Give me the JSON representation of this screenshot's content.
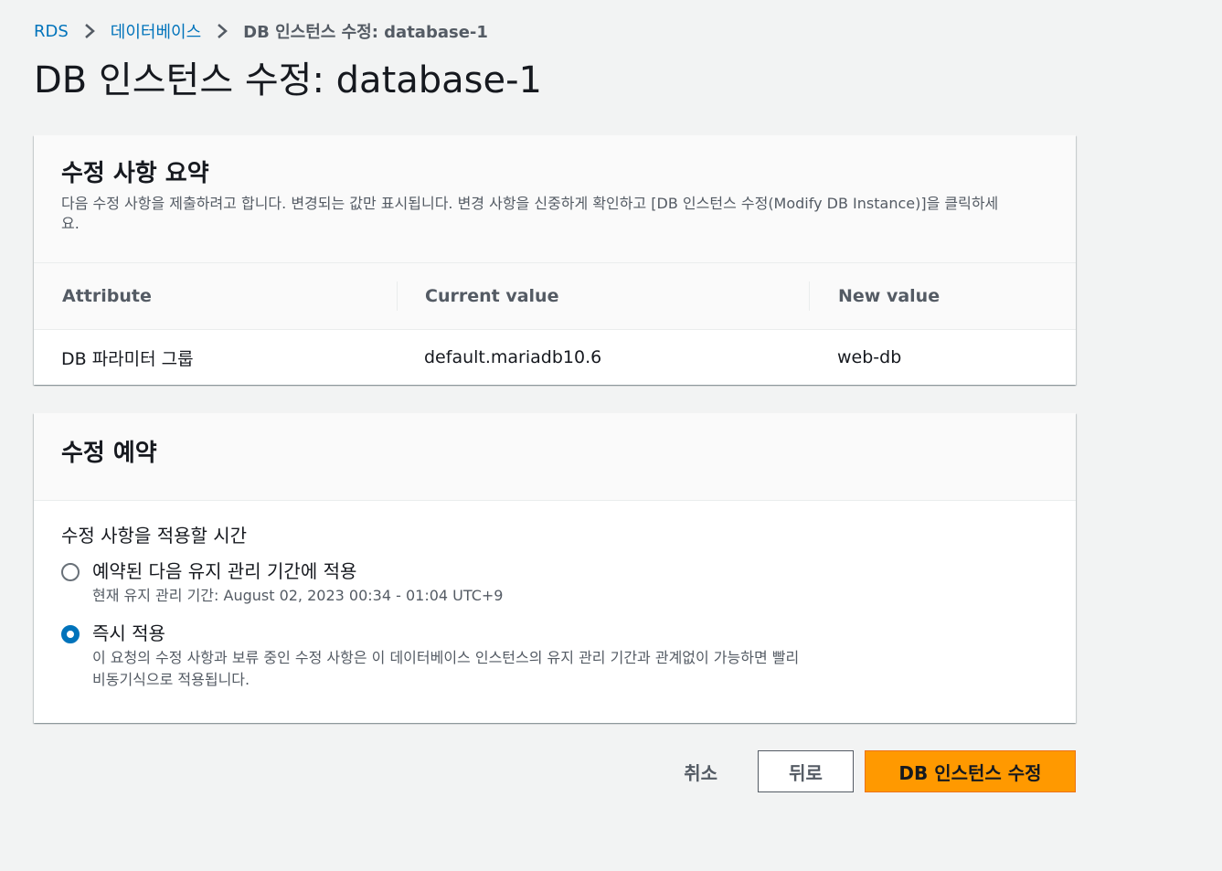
{
  "breadcrumb": {
    "items": [
      "RDS",
      "데이터베이스"
    ],
    "current": "DB 인스턴스 수정: database-1"
  },
  "page_title": "DB 인스턴스 수정: database-1",
  "summary": {
    "title": "수정 사항 요약",
    "description": "다음 수정 사항을 제출하려고 합니다. 변경되는 값만 표시됩니다. 변경 사항을 신중하게 확인하고 [DB 인스턴스 수정(Modify DB Instance)]을 클릭하세요.",
    "columns": [
      "Attribute",
      "Current value",
      "New value"
    ],
    "rows": [
      [
        "DB 파라미터 그룹",
        "default.mariadb10.6",
        "web-db"
      ]
    ]
  },
  "schedule": {
    "title": "수정 예약",
    "field_label": "수정 사항을 적용할 시간",
    "options": [
      {
        "label": "예약된 다음 유지 관리 기간에 적용",
        "sub": "현재 유지 관리 기간: August 02, 2023 00:34 - 01:04 UTC+9",
        "selected": false
      },
      {
        "label": "즉시 적용",
        "sub": "이 요청의 수정 사항과 보류 중인 수정 사항은 이 데이터베이스 인스턴스의 유지 관리 기간과 관계없이 가능하면 빨리 비동기식으로 적용됩니다.",
        "selected": true
      }
    ]
  },
  "actions": {
    "cancel_label": "취소",
    "back_label": "뒤로",
    "submit_label": "DB 인스턴스 수정"
  },
  "colors": {
    "link": "#0073bb",
    "primary": "#ff9900",
    "radio_selected": "#0073bb"
  }
}
